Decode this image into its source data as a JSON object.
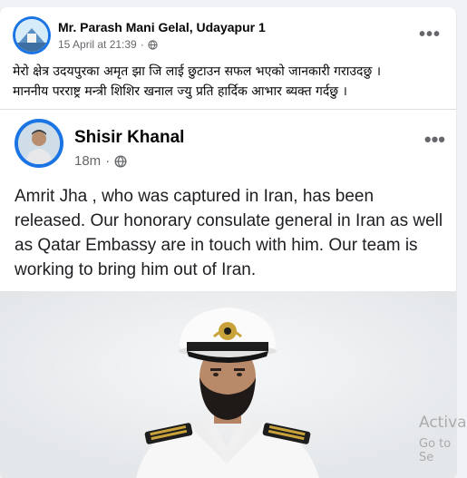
{
  "post": {
    "author": "Mr. Parash Mani Gelal, Udayapur 1",
    "date": "15 April at 21:39",
    "audience_icon": "globe-icon",
    "more_icon": "more-options-icon",
    "more_label": "•••",
    "text_line1": "मेरो क्षेत्र उदयपुरका अमृत झा जि लाई छुटाउन सफल भएको जानकारी गराउदछु ।",
    "text_line2": "माननीय परराष्ट्र मन्त्री शिशिर खनाल ज्यु प्रति हार्दिक आभार ब्यक्त गर्दछु ।"
  },
  "shared": {
    "author": "Shisir Khanal",
    "time": "18m",
    "audience_icon": "globe-icon",
    "more_label": "•••",
    "text": "Amrit Jha , who was captured in Iran, has been released. Our honorary consulate general in Iran as well as Qatar Embassy are in touch with him. Our team is working to bring him out of Iran.",
    "photo_icon": "officer-photo"
  },
  "watermark": {
    "title": "Activa",
    "subtitle": "Go to Se"
  },
  "colors": {
    "accent": "#1b74e4",
    "text": "#050505",
    "secondary": "#65676b",
    "background": "#f0f2f5"
  }
}
